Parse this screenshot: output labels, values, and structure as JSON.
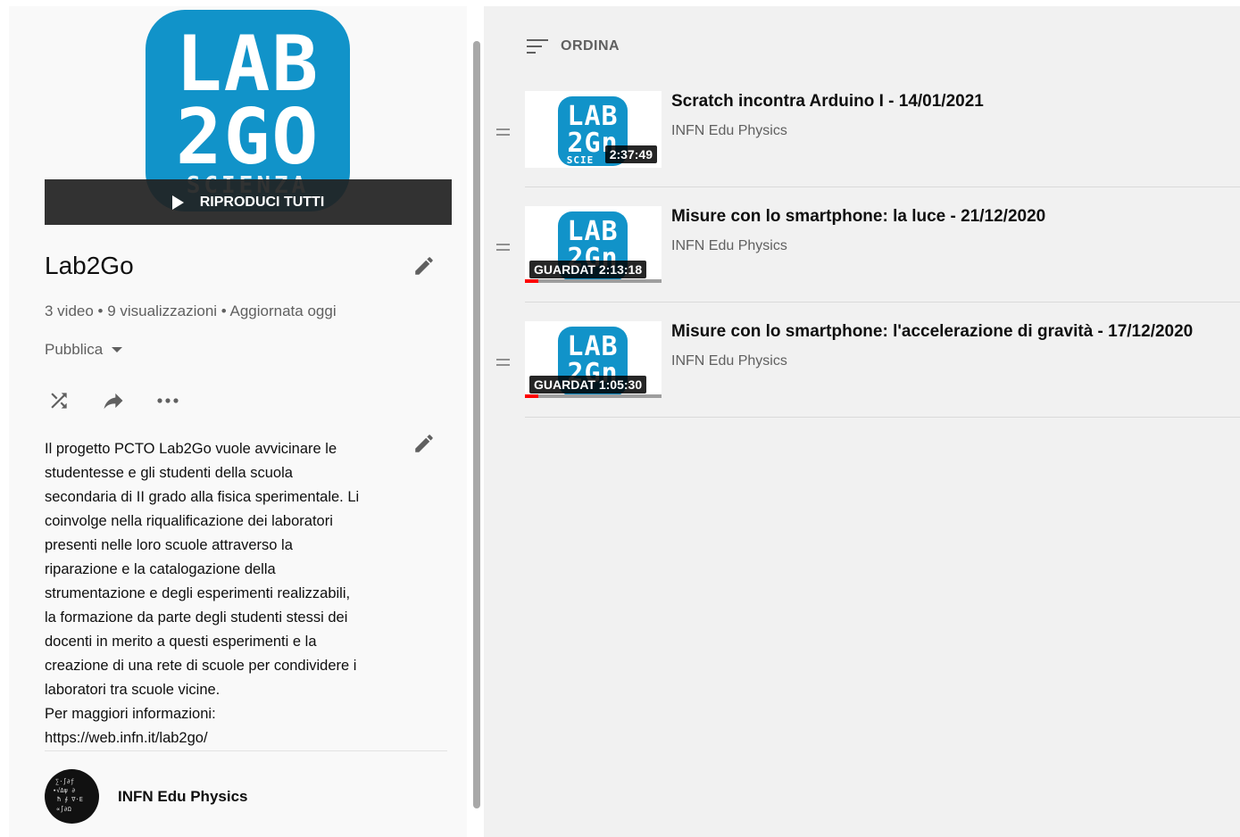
{
  "playlist": {
    "logo": {
      "line1": "LAB",
      "line2": "2GO",
      "line3": "SCIENZA"
    },
    "play_all_label": "RIPRODUCI TUTTI",
    "title": "Lab2Go",
    "stats": "3 video • 9 visualizzazioni • Aggiornata oggi",
    "privacy": "Pubblica",
    "description": "Il progetto PCTO Lab2Go vuole avvicinare le\nstudentesse e gli studenti della scuola\nsecondaria di II grado alla fisica sperimentale. Li\ncoinvolge nella riqualificazione dei laboratori\npresenti nelle loro scuole attraverso la\nriparazione e la catalogazione della\nstrumentazione e degli esperimenti realizzabili,\nla formazione da parte degli studenti stessi dei\ndocenti in merito a questi esperimenti e la\ncreazione di una rete di scuole per condividere i\nlaboratori tra scuole vicine.\nPer maggiori informazioni:\nhttps://web.infn.it/lab2go/",
    "owner": "INFN Edu Physics",
    "icons": {
      "edit": "pencil-icon",
      "shuffle": "shuffle-icon",
      "share": "share-icon",
      "more": "more-icon"
    }
  },
  "sort_label": "ORDINA",
  "videos": [
    {
      "title": "Scratch incontra Arduino I - 14/01/2021",
      "channel": "INFN Edu Physics",
      "duration": "2:37:49",
      "watched_label": "",
      "thumb_l1": "LAB",
      "thumb_l2": "2Gn",
      "thumb_l3": "SCIE",
      "progress": 0
    },
    {
      "title": "Misure con lo smartphone: la luce - 21/12/2020",
      "channel": "INFN Edu Physics",
      "duration": "2:13:18",
      "watched_label": "GUARDAT",
      "thumb_l1": "LAB",
      "thumb_l2": "2Gn",
      "thumb_l3": "",
      "progress": 0.1
    },
    {
      "title": "Misure con lo smartphone: l'accelerazione di gravità - 17/12/2020",
      "channel": "INFN Edu Physics",
      "duration": "1:05:30",
      "watched_label": "GUARDAT",
      "thumb_l1": "LAB",
      "thumb_l2": "2Gn",
      "thumb_l3": "",
      "progress": 0.1
    }
  ],
  "colors": {
    "logo_blue": "#1193c9",
    "progress_red": "#ff0000"
  }
}
